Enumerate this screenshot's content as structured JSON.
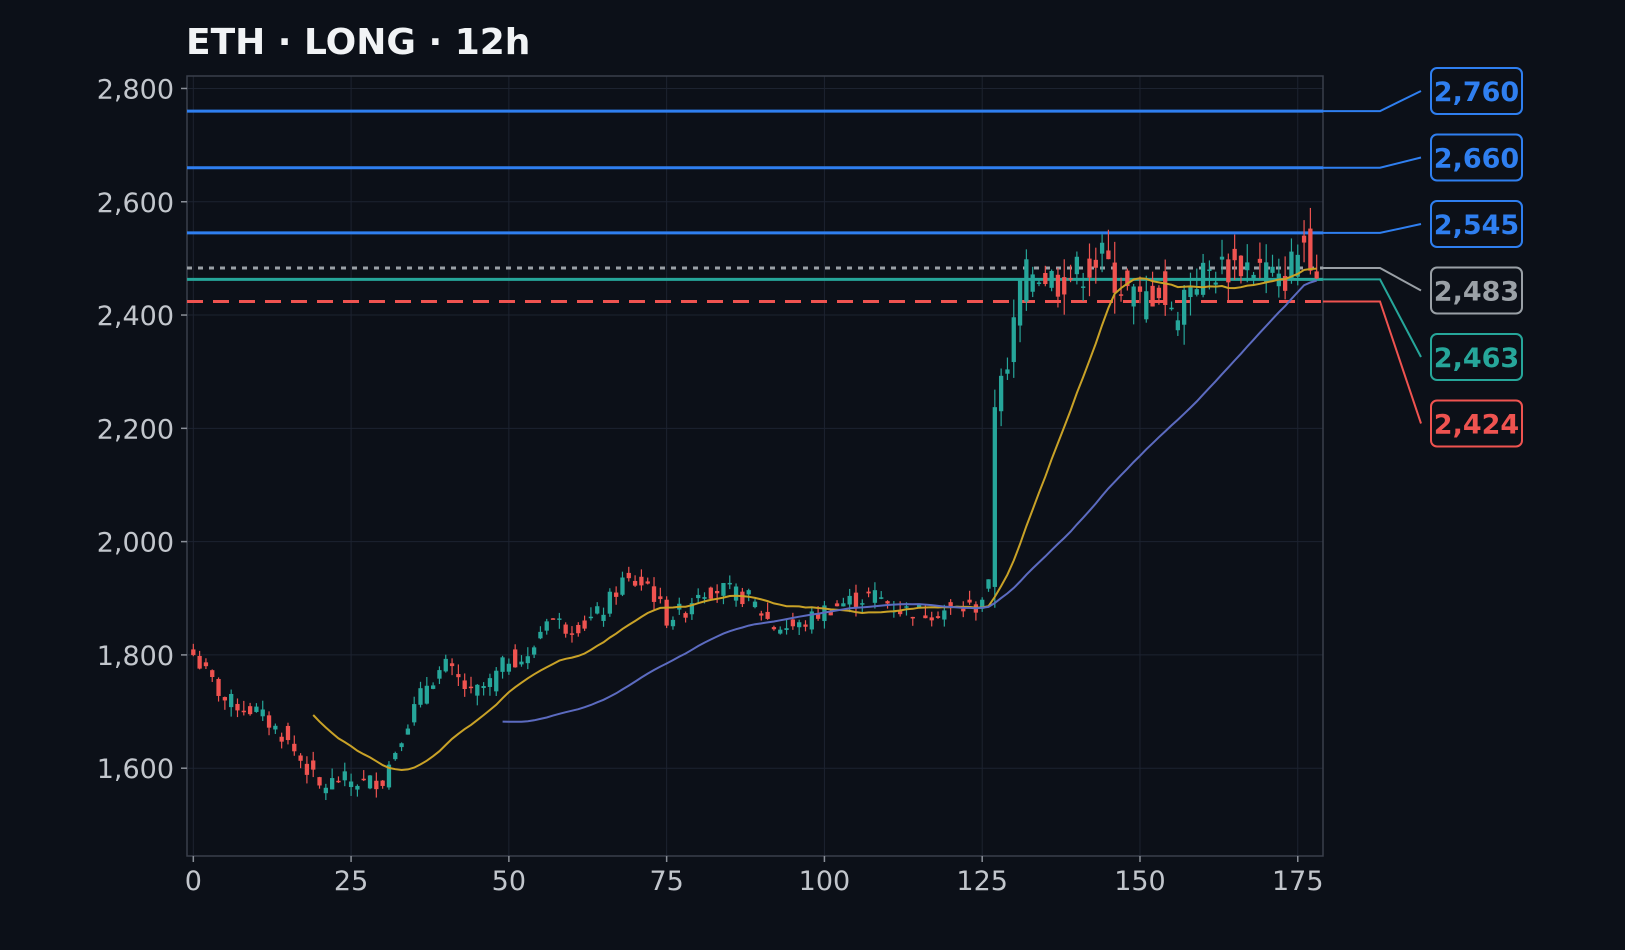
{
  "chart_data": {
    "type": "candlestick",
    "title": "ETH · LONG · 12h",
    "xlabel": "",
    "ylabel": "",
    "xlim": [
      -1,
      179
    ],
    "ylim": [
      1445,
      2822
    ],
    "grid": true,
    "x_ticks": [
      0,
      25,
      50,
      75,
      100,
      125,
      150,
      175
    ],
    "y_ticks": [
      1600,
      1800,
      2000,
      2200,
      2400,
      2600,
      2800
    ],
    "colors": {
      "background": "#0c1018",
      "up": "#26a69a",
      "down": "#ef5350",
      "ma_fast": "#c9a227",
      "ma_slow": "#5c6bc0",
      "target": "#2f7ff0",
      "entry": "#9aa0a6",
      "current": "#26a69a",
      "stop": "#ef5350"
    },
    "anchors": [
      [
        0,
        1800
      ],
      [
        5,
        1720
      ],
      [
        10,
        1700
      ],
      [
        14,
        1660
      ],
      [
        18,
        1600
      ],
      [
        20,
        1565
      ],
      [
        23,
        1580
      ],
      [
        27,
        1575
      ],
      [
        30,
        1580
      ],
      [
        33,
        1660
      ],
      [
        37,
        1750
      ],
      [
        40,
        1780
      ],
      [
        44,
        1730
      ],
      [
        47,
        1750
      ],
      [
        50,
        1795
      ],
      [
        53,
        1790
      ],
      [
        56,
        1870
      ],
      [
        59,
        1850
      ],
      [
        62,
        1855
      ],
      [
        65,
        1880
      ],
      [
        68,
        1930
      ],
      [
        72,
        1925
      ],
      [
        75,
        1865
      ],
      [
        78,
        1880
      ],
      [
        80,
        1915
      ],
      [
        84,
        1915
      ],
      [
        88,
        1900
      ],
      [
        92,
        1850
      ],
      [
        96,
        1850
      ],
      [
        100,
        1880
      ],
      [
        104,
        1895
      ],
      [
        108,
        1905
      ],
      [
        112,
        1880
      ],
      [
        116,
        1875
      ],
      [
        120,
        1880
      ],
      [
        124,
        1885
      ],
      [
        126,
        1920
      ],
      [
        127,
        2250
      ],
      [
        129,
        2300
      ],
      [
        131,
        2450
      ],
      [
        133,
        2480
      ],
      [
        137,
        2460
      ],
      [
        141,
        2480
      ],
      [
        144,
        2500
      ],
      [
        147,
        2450
      ],
      [
        150,
        2420
      ],
      [
        153,
        2450
      ],
      [
        155,
        2395
      ],
      [
        158,
        2460
      ],
      [
        162,
        2480
      ],
      [
        166,
        2490
      ],
      [
        170,
        2480
      ],
      [
        172,
        2450
      ],
      [
        174,
        2490
      ],
      [
        176,
        2530
      ],
      [
        178,
        2490
      ]
    ],
    "ma_fast_from": 19,
    "ma_slow_from": 49,
    "levels": [
      {
        "label": "2,760",
        "value": 2760,
        "kind": "target",
        "style": "solid"
      },
      {
        "label": "2,660",
        "value": 2660,
        "kind": "target",
        "style": "solid"
      },
      {
        "label": "2,545",
        "value": 2545,
        "kind": "target",
        "style": "solid"
      },
      {
        "label": "2,483",
        "value": 2483,
        "kind": "entry",
        "style": "dotted"
      },
      {
        "label": "2,463",
        "value": 2463,
        "kind": "current",
        "style": "solid"
      },
      {
        "label": "2,424",
        "value": 2424,
        "kind": "stop",
        "style": "dashed"
      }
    ]
  }
}
